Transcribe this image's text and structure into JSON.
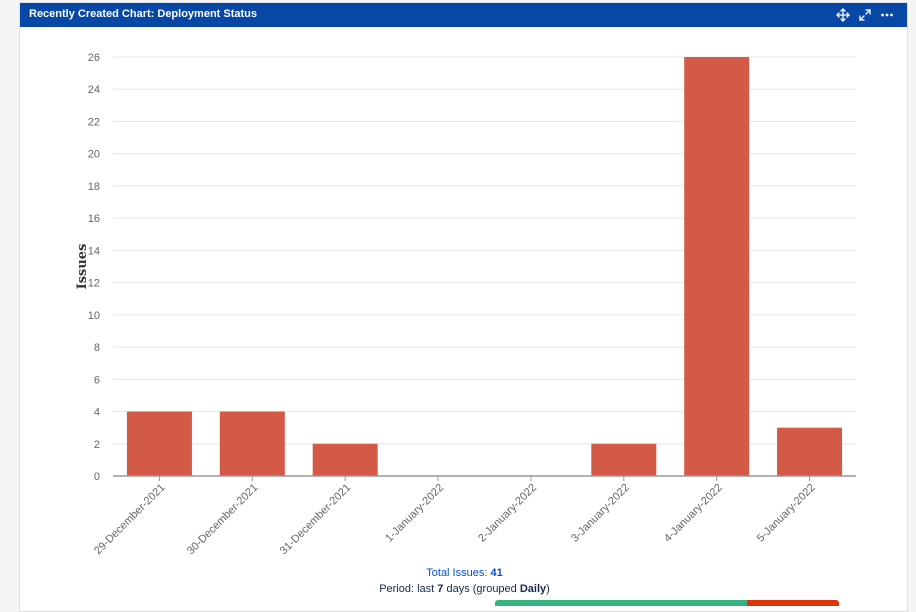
{
  "gadget": {
    "title": "Recently Created Chart: Deployment Status",
    "icons": [
      "move-icon",
      "expand-icon",
      "more-icon"
    ]
  },
  "chart_data": {
    "type": "bar",
    "ylabel": "Issues",
    "xlabel": "",
    "categories": [
      "29-December-2021",
      "30-December-2021",
      "31-December-2021",
      "1-January-2022",
      "2-January-2022",
      "3-January-2022",
      "4-January-2022",
      "5-January-2022"
    ],
    "values": [
      4,
      4,
      2,
      0,
      0,
      2,
      26,
      3
    ],
    "ylim": [
      0,
      26
    ],
    "yticks": [
      0,
      2,
      4,
      6,
      8,
      10,
      12,
      14,
      16,
      18,
      20,
      22,
      24,
      26
    ],
    "grid": true,
    "bar_color": "#d35a46"
  },
  "footer": {
    "total_label": "Total Issues: ",
    "total_value": "41",
    "period_prefix": "Period: last ",
    "period_days": "7",
    "period_middle": " days (grouped ",
    "period_group": "Daily",
    "period_suffix": ")"
  },
  "colors": {
    "titlebar": "#0747a6",
    "link": "#0052cc",
    "status_green": "#36b37e",
    "status_red": "#de350b"
  }
}
